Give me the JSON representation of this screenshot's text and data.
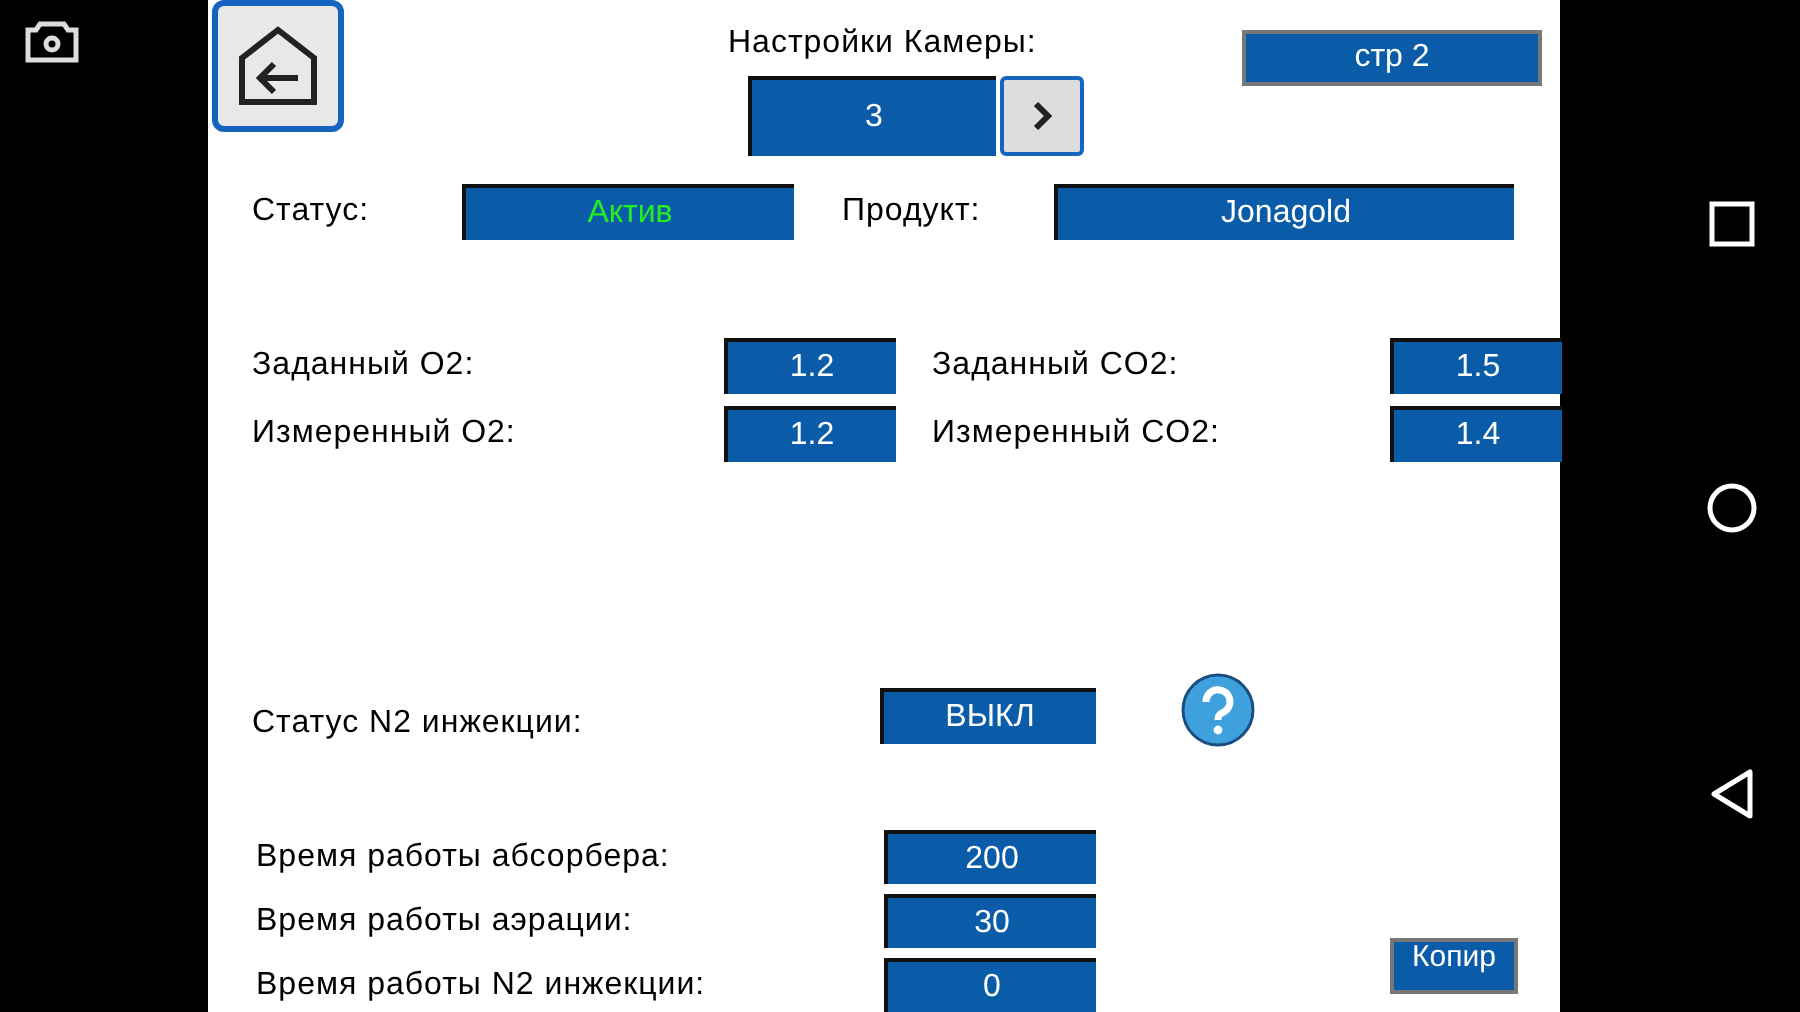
{
  "header": {
    "title": "Настройки Камеры:",
    "camera": "3",
    "page": "стр 2"
  },
  "status": {
    "label": "Статус:",
    "value": "Актив",
    "active": true
  },
  "product": {
    "label": "Продукт:",
    "value": "Jonagold"
  },
  "gas": [
    {
      "label": "Заданный O2:",
      "value": "1.2"
    },
    {
      "label": "Заданный CO2:",
      "value": "1.5"
    },
    {
      "label": "Измеренный O2:",
      "value": "1.2"
    },
    {
      "label": "Измеренный CO2:",
      "value": "1.4"
    }
  ],
  "n2_status": {
    "label": "Статус N2 инжекции:",
    "value": "ВЫКЛ"
  },
  "timers": [
    {
      "label": "Время работы абсорбера:",
      "value": "200"
    },
    {
      "label": "Время работы аэрации:",
      "value": "30"
    },
    {
      "label": "Время работы N2 инжекции:",
      "value": "0"
    }
  ],
  "copy_button": "Копир"
}
